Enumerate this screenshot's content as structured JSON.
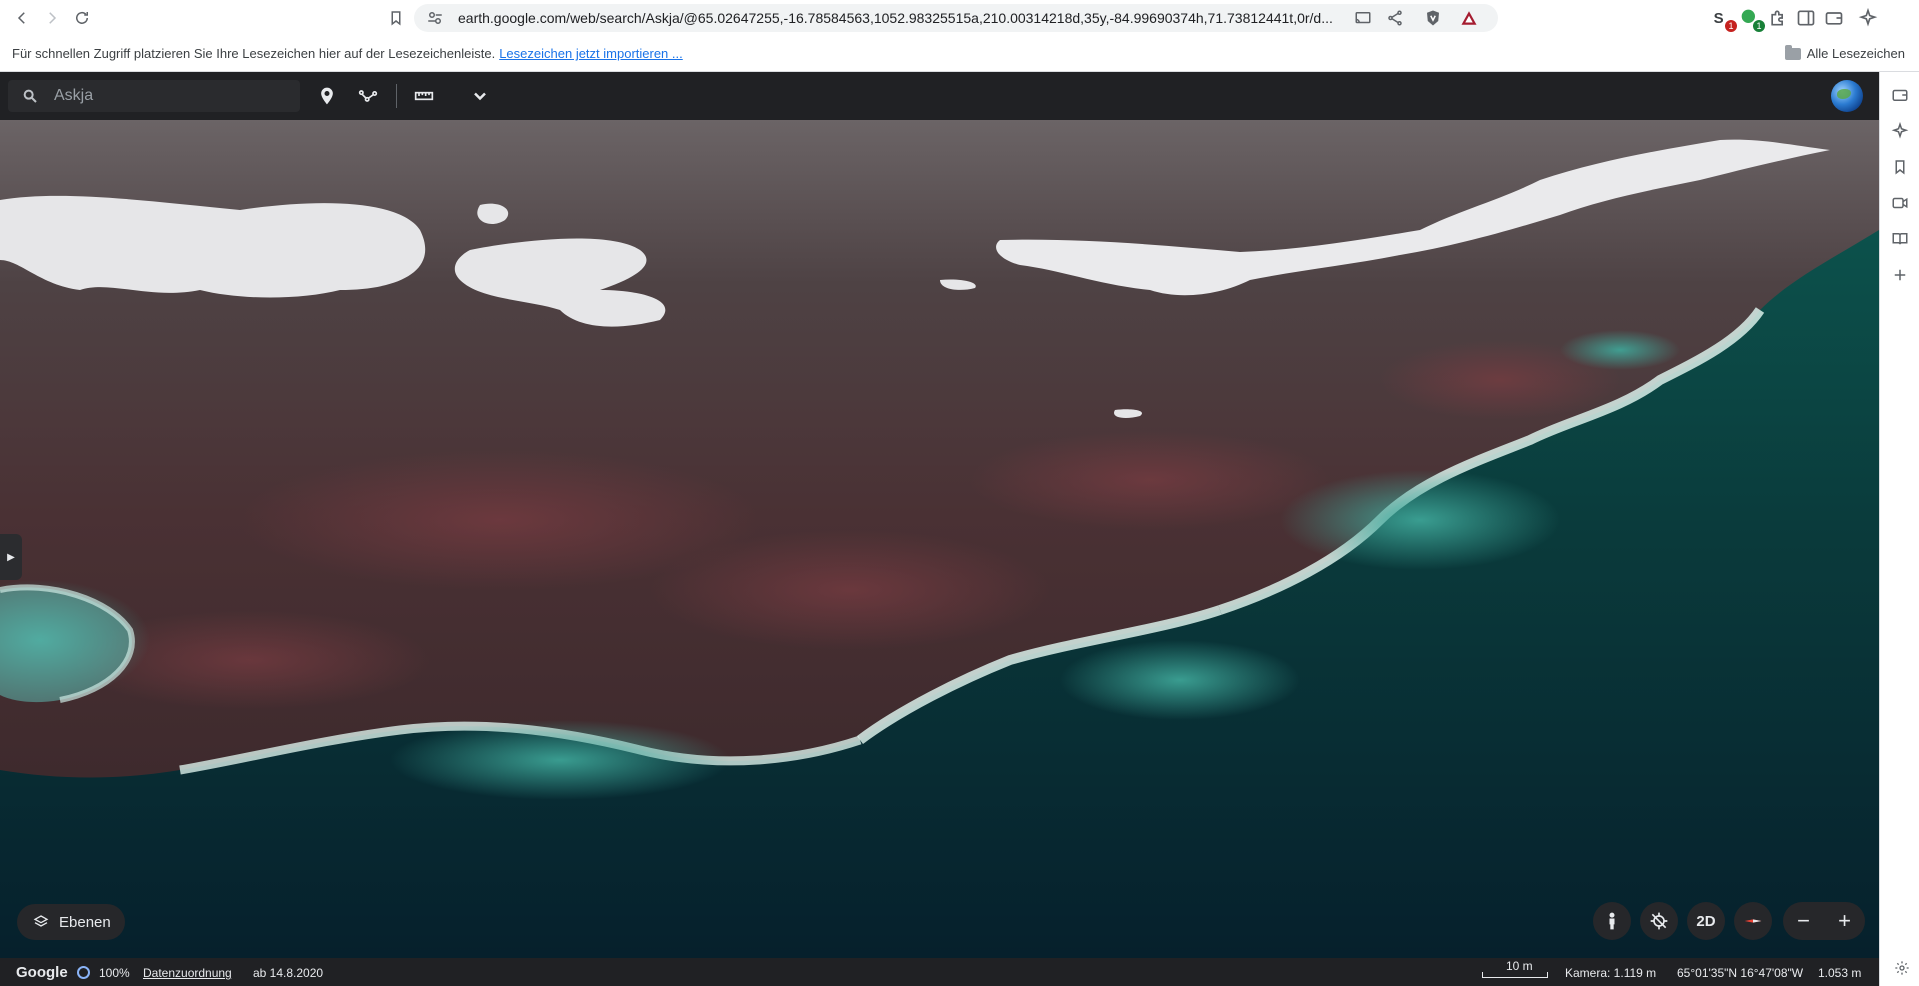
{
  "browser": {
    "url": "earth.google.com/web/search/Askja/@65.02647255,-16.78584563,1052.98325515a,210.00314218d,35y,-84.99690374h,71.73812441t,0r/d...",
    "extensions": [
      {
        "name": "ext-1",
        "badge": "1",
        "badge_color": "#c5221f"
      },
      {
        "name": "ext-2",
        "badge": "1",
        "badge_color": "#188038"
      }
    ],
    "bookmarks_hint": "Für schnellen Zugriff platzieren Sie Ihre Lesezeichen hier auf der Lesezeichenleiste.",
    "bookmarks_import_link": "Lesezeichen jetzt importieren ...",
    "all_bookmarks": "Alle Lesezeichen"
  },
  "earth": {
    "search": {
      "value": "Askja",
      "placeholder": "Askja"
    },
    "layers_label": "Ebenen",
    "view_toggle": "2D",
    "status": {
      "brand": "Google",
      "load_percent": "100%",
      "attribution": "Datenzuordnung",
      "imagery_date": "ab 14.8.2020",
      "scale": "10 m",
      "camera": "Kamera: 1.119 m",
      "coordinates": "65°01'35\"N 16°47'08\"W",
      "elevation": "1.053 m"
    }
  },
  "colors": {
    "toolbar_bg": "#202124",
    "water": "#0b3a3a",
    "rock": "#4a3436",
    "snow": "#e8e8ea"
  }
}
